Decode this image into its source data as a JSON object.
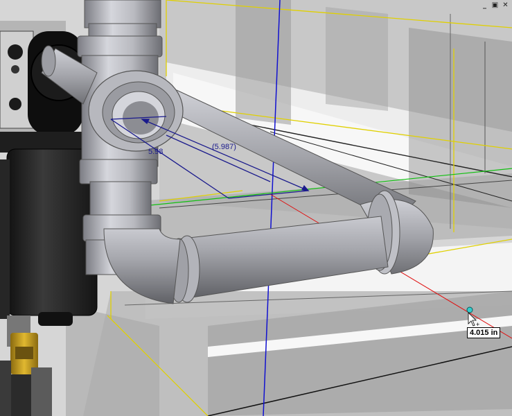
{
  "window": {
    "controls": [
      "minimize-icon",
      "restore-icon",
      "close-icon"
    ],
    "glyphs": [
      "_",
      "▣",
      "✕"
    ]
  },
  "dimensions": {
    "driven_dimension": "(5.987)",
    "partial_dimension": "5.98"
  },
  "measure_readout": {
    "value": "4.015 in"
  },
  "colors": {
    "x_axis": "#e01010",
    "y_axis": "#1010d0",
    "z_axis": "#10c010",
    "sketch_lines": "#e0d000",
    "dimension_color": "#1a1a8c",
    "snap_point": "#33cccc"
  }
}
